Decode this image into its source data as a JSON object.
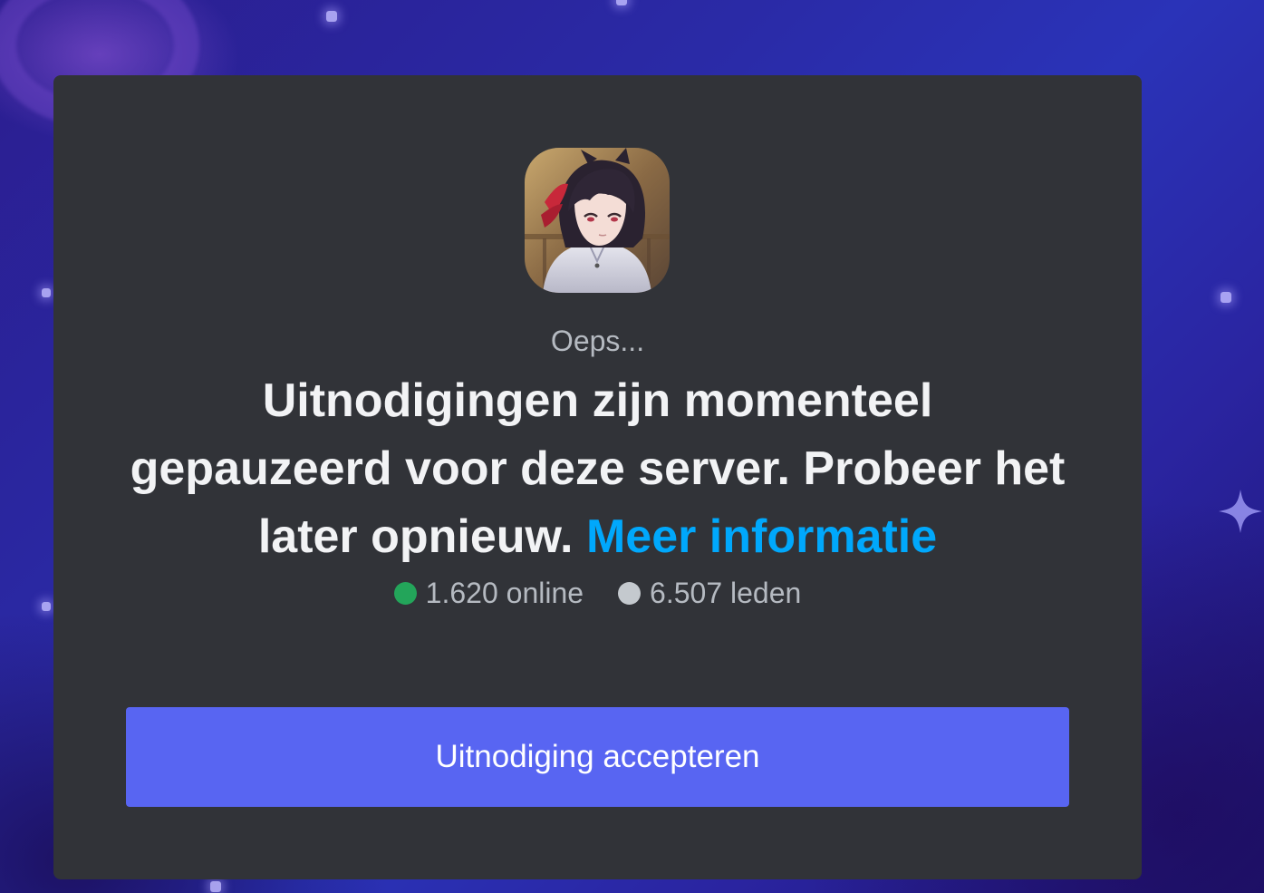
{
  "invite": {
    "server_icon": "server-avatar-anime-character",
    "subtitle": "Oeps...",
    "message": "Uitnodigingen zijn momenteel gepauzeerd voor deze server. Probeer het later opnieuw.",
    "learn_more_link": "Meer informatie",
    "online_count": "1.620 online",
    "member_count": "6.507 leden",
    "accept_button": "Uitnodiging accepteren"
  },
  "colors": {
    "card_background": "#313338",
    "accent_button": "#5865f2",
    "link": "#00a8fc",
    "online_dot": "#23a55a",
    "members_dot": "#c4c9ce",
    "page_background": "#2a2aa6"
  }
}
